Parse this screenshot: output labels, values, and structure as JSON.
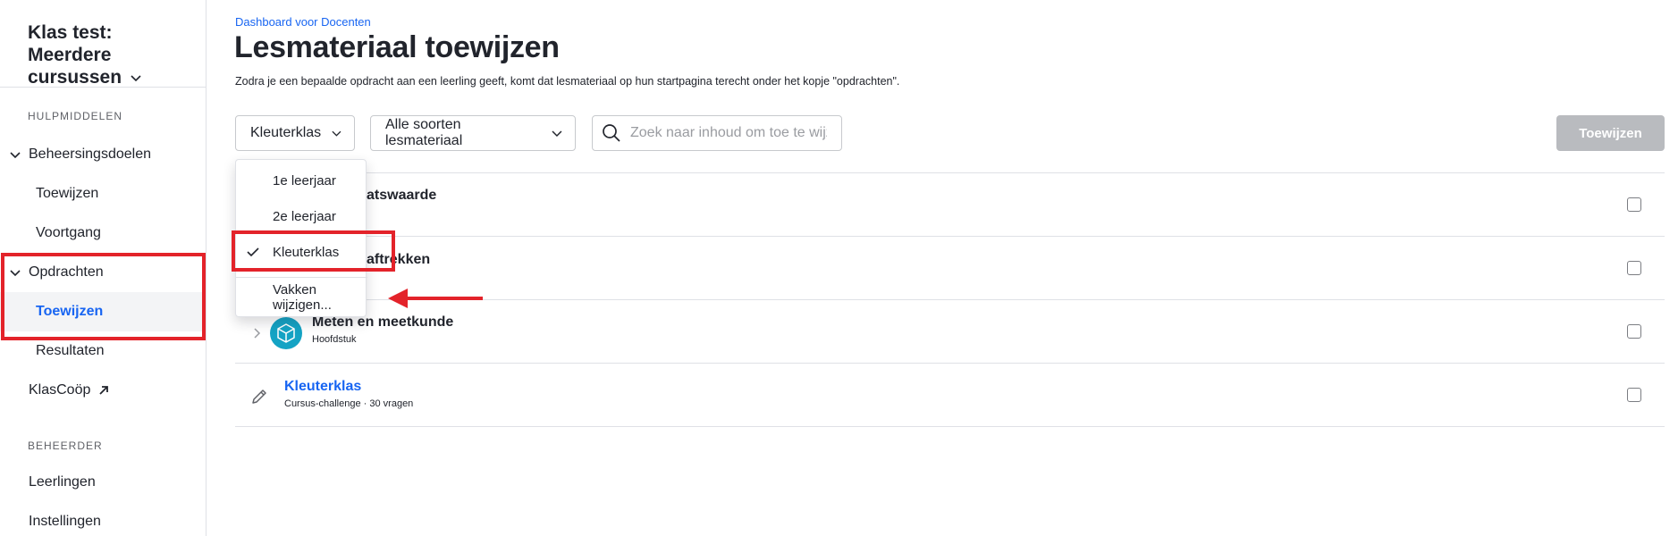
{
  "sidebar": {
    "class_title": "Klas test: Meerdere cursussen",
    "sections": {
      "tools_label": "HULPMIDDELEN",
      "admin_label": "BEHEERDER"
    },
    "items": {
      "mastery": "Beheersingsdoelen",
      "mastery_assign": "Toewijzen",
      "mastery_progress": "Voortgang",
      "assignments": "Opdrachten",
      "assignments_assign": "Toewijzen",
      "assignments_results": "Resultaten",
      "klascoop": "KlasCoöp",
      "students": "Leerlingen",
      "settings": "Instellingen"
    }
  },
  "header": {
    "breadcrumb": "Dashboard voor Docenten",
    "title": "Lesmateriaal toewijzen",
    "description": "Zodra je een bepaalde opdracht aan een leerling geeft, komt dat lesmateriaal op hun startpagina terecht onder het kopje \"opdrachten\"."
  },
  "toolbar": {
    "course_filter": "Kleuterklas",
    "type_filter": "Alle soorten lesmateriaal",
    "search_placeholder": "Zoek naar inhoud om toe te wijzen",
    "assign_button": "Toewijzen"
  },
  "rows": [
    {
      "title_visible": "atswaarde"
    },
    {
      "title_visible": "aftrekken"
    },
    {
      "title": "Meten en meetkunde",
      "subtitle": "Hoofdstuk",
      "icon": "cube-icon"
    },
    {
      "title": "Kleuterklas",
      "subtitle": "Cursus-challenge · 30 vragen",
      "icon": "pencil-icon"
    }
  ],
  "dropdown": {
    "options": [
      "1e leerjaar",
      "2e leerjaar",
      "Kleuterklas"
    ],
    "selected": "Kleuterklas",
    "edit_label": "Vakken wijzigen..."
  },
  "colors": {
    "accent": "#1865f2",
    "annotation_red": "#e3232a",
    "disabled_button": "#b9bbbf",
    "cube_icon_bg": "#14a3c4"
  }
}
